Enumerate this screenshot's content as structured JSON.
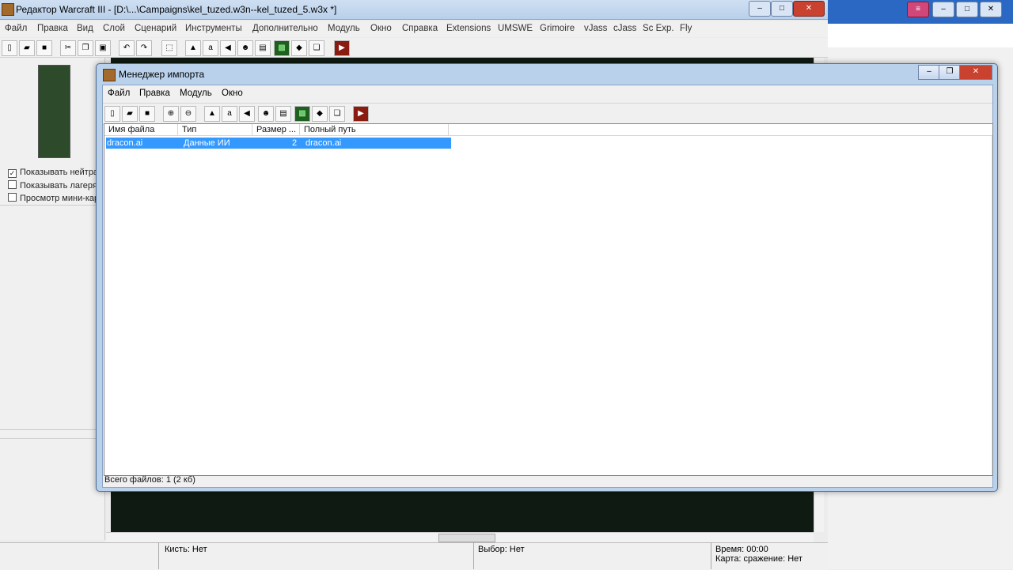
{
  "main": {
    "title": "Редактор Warcraft III  - [D:\\...\\Campaigns\\kel_tuzed.w3n--kel_tuzed_5.w3x *]",
    "menu": [
      "Файл",
      "Правка",
      "Вид",
      "Слой",
      "Сценарий",
      "Инструменты",
      "Дополнительно",
      "Модуль",
      "Окно",
      "Справка",
      "Extensions",
      "UMSWE",
      "Grimoire",
      "vJass",
      "cJass",
      "Sc Exp.",
      "Fly"
    ],
    "left_checks": [
      {
        "label": "Показывать нейтра",
        "checked": true
      },
      {
        "label": "Показывать лагеря",
        "checked": false
      },
      {
        "label": "Просмотр мини-кар",
        "checked": false
      }
    ],
    "status": {
      "brush": "Кисть: Нет",
      "selection": "Выбор: Нет",
      "time": "Время: 00:00",
      "map": "Карта: сражение: Нет"
    }
  },
  "dialog": {
    "title": "Менеджер импорта",
    "menu": [
      "Файл",
      "Правка",
      "Модуль",
      "Окно"
    ],
    "columns": [
      "Имя файла",
      "Тип",
      "Размер ...",
      "Полный путь"
    ],
    "rows": [
      {
        "name": "dracon.ai",
        "type": "Данные ИИ",
        "size": "2",
        "path": "dracon.ai"
      }
    ],
    "status": "Всего файлов: 1 (2 кб)"
  }
}
